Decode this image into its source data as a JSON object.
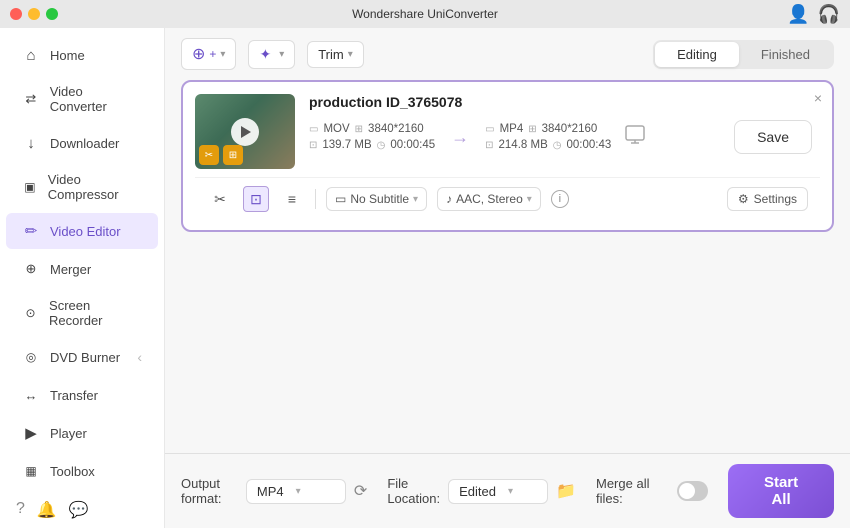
{
  "app": {
    "title": "Wondershare UniConverter"
  },
  "titlebar": {
    "title": "Wondershare UniConverter"
  },
  "sidebar": {
    "items": [
      {
        "id": "home",
        "label": "Home",
        "icon": "⌂"
      },
      {
        "id": "video-converter",
        "label": "Video Converter",
        "icon": "⇄"
      },
      {
        "id": "downloader",
        "label": "Downloader",
        "icon": "↓"
      },
      {
        "id": "video-compressor",
        "label": "Video Compressor",
        "icon": "⊞"
      },
      {
        "id": "video-editor",
        "label": "Video Editor",
        "icon": "✏",
        "active": true
      },
      {
        "id": "merger",
        "label": "Merger",
        "icon": "⊕"
      },
      {
        "id": "screen-recorder",
        "label": "Screen Recorder",
        "icon": "⊙"
      },
      {
        "id": "dvd-burner",
        "label": "DVD Burner",
        "icon": "◎"
      },
      {
        "id": "transfer",
        "label": "Transfer",
        "icon": "↔"
      },
      {
        "id": "player",
        "label": "Player",
        "icon": "▶"
      },
      {
        "id": "toolbox",
        "label": "Toolbox",
        "icon": "⊞"
      }
    ],
    "bottom_icons": [
      "?",
      "🔔",
      "💬"
    ]
  },
  "toolbar": {
    "add_btn_label": "+",
    "effects_btn_label": "Effects",
    "trim_label": "Trim",
    "tab_editing": "Editing",
    "tab_finished": "Finished"
  },
  "file_card": {
    "title": "production ID_3765078",
    "source": {
      "format": "MOV",
      "resolution": "3840*2160",
      "size": "139.7 MB",
      "duration": "00:00:45"
    },
    "output": {
      "format": "MP4",
      "resolution": "3840*2160",
      "size": "214.8 MB",
      "duration": "00:00:43"
    },
    "save_label": "Save",
    "close_label": "×"
  },
  "edit_toolbar": {
    "subtitle_label": "No Subtitle",
    "subtitle_placeholder": "No Subtitle",
    "audio_label": "AAC, Stereo",
    "settings_label": "Settings"
  },
  "bottom_bar": {
    "output_format_label": "Output format:",
    "output_format_value": "MP4",
    "file_location_label": "File Location:",
    "file_location_value": "Edited",
    "merge_label": "Merge all files:",
    "start_all_label": "Start All"
  }
}
